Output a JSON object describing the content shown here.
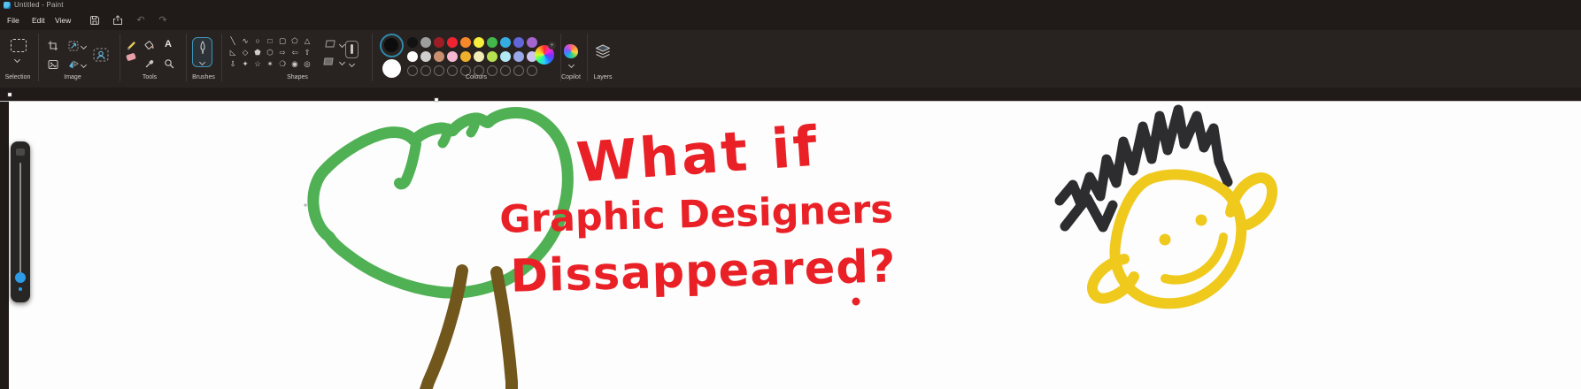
{
  "window": {
    "title": "Untitled - Paint"
  },
  "menu": {
    "file": "File",
    "edit": "Edit",
    "view": "View",
    "icons": [
      "save-icon",
      "share-icon",
      "undo-icon",
      "redo-icon"
    ],
    "undo_glyph": "↶",
    "redo_glyph": "↷"
  },
  "ribbon": {
    "labels": {
      "selection": "Selection",
      "image": "Image",
      "tools": "Tools",
      "brushes": "Brushes",
      "shapes": "Shapes",
      "colours": "Colours",
      "copilot": "Copilot",
      "layers": "Layers"
    },
    "tools": {
      "text_tool": "A"
    },
    "shapes_glyphs": [
      "╲",
      "∿",
      "○",
      "□",
      "▢",
      "⬠",
      "△",
      "◺",
      "◇",
      "⬟",
      "⬡",
      "⇨",
      "⇦",
      "⇧",
      "⇩",
      "✦",
      "☆",
      "✶",
      "❍",
      "◉",
      "◎"
    ],
    "palette": {
      "foreground": "#0d0d0d",
      "background": "#ffffff",
      "accent_ring": "#2f88ab",
      "row1": [
        "#121212",
        "#9e9e9e",
        "#9d1d26",
        "#ee2432",
        "#f7882a",
        "#f7ef3c",
        "#43b64c",
        "#35ace2",
        "#6166d8",
        "#a565cf"
      ],
      "row2": [
        "#ffffff",
        "#cfcfcf",
        "#c98f6e",
        "#f6b7d0",
        "#eeb02c",
        "#f2edb7",
        "#b8e14f",
        "#b3e8f5",
        "#98a8e8",
        "#cdc5f0"
      ],
      "empty_slots": 10
    },
    "wheel_plus": "+"
  },
  "canvas": {
    "line1": "What if",
    "line2": "Graphic Designers",
    "line3": "Dissappeared?"
  },
  "art": {
    "green": "#4fb154",
    "brown": "#72571d",
    "red": "#e92127",
    "yellow": "#f0c91d",
    "hair": "#2d2d30"
  },
  "slider": {
    "thumb_color": "#2e9be6"
  }
}
